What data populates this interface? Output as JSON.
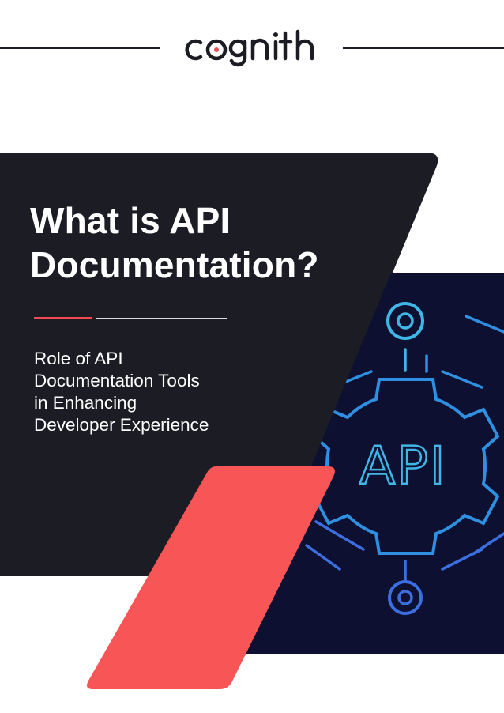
{
  "brand": {
    "logo_text": "cognith",
    "accent_color": "#f24b4f",
    "dark_color": "#1c1d24",
    "art_background": "#0d1030",
    "art_line_color": "#3fb6e6"
  },
  "cover": {
    "title_line1": "What is API",
    "title_line2": "Documentation?",
    "subtitle_line1": "Role of API",
    "subtitle_line2": "Documentation Tools",
    "subtitle_line3": "in Enhancing",
    "subtitle_line4": "Developer Experience"
  },
  "illustration": {
    "label": "API",
    "icon": "gear-api-icon"
  }
}
